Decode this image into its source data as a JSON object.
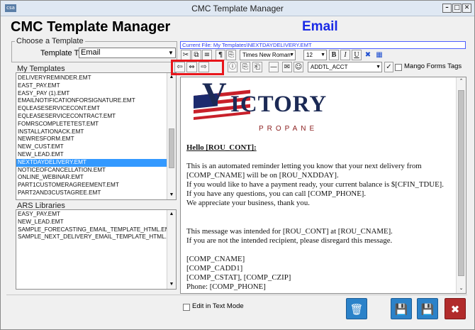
{
  "window": {
    "title": "CMC Template Manager",
    "app_icon_text": "csa",
    "controls": {
      "minimize": "–",
      "maximize": "□",
      "close": "✕"
    }
  },
  "header": {
    "app_title": "CMC Template Manager",
    "section": "Email",
    "section_color": "#1a2ae6"
  },
  "choose_template": {
    "legend": "Choose a Template",
    "type_label": "Template Type",
    "type_value": "Email"
  },
  "my_templates": {
    "label": "My Templates",
    "items": [
      "DELIVERYREMINDER.EMT",
      "EAST_PAY.EMT",
      "EASY_PAY (1).EMT",
      "EMAILNOTIFICATIONFORSIGNATURE.EMT",
      "EQLEASESERVICECONT.EMT",
      "EQLEASESERVICECONTRACT.EMT",
      "FOMRSCOMPLETETEST.EMT",
      "INSTALLATIONACK.EMT",
      "NEWRESFORM.EMT",
      "NEW_CUST.EMT",
      "NEW_LEAD.EMT",
      "NEXTDAYDELIVERY.EMT",
      "NOTICEOFCANCELLATION.EMT",
      "ONLINE_WEBINAR.EMT",
      "PART1CUSTOMERAGREEMENT.EMT",
      "PART2AND3CUSTAGREE.EMT"
    ],
    "selected": "NEXTDAYDELIVERY.EMT"
  },
  "ars_libraries": {
    "label": "ARS Libraries",
    "items": [
      "EASY_PAY.EMT",
      "NEW_LEAD.EMT",
      "SAMPLE_FORECASTING_EMAIL_TEMPLATE_HTML.EMT",
      "SAMPLE_NEXT_DELIVERY_EMAIL_TEMPLATE_HTML.EMT"
    ]
  },
  "editor": {
    "current_file": "Current File: My Templates\\NEXTDAYDELIVERY.EMT",
    "font_name": "Times New Roman",
    "font_size": "12",
    "field_select": "ADDTL_ACCT",
    "mango_label": "Mango Forms Tags",
    "toolbar_icons": {
      "cut": "✂",
      "copy": "⧉",
      "paste": "📋",
      "bullets": "≡",
      "format": "¶",
      "bold": "B",
      "italic": "I",
      "underline": "U",
      "clear": "✖",
      "table": "▦",
      "align_left": "⇦",
      "align_center": "⇔",
      "align_right": "⇨",
      "info": "ⓘ",
      "link": "⎘",
      "unlink": "⎗",
      "hr": "—",
      "image": "✉",
      "smiley": "☺",
      "apply": "✓"
    },
    "logo": {
      "v": "V",
      "rest": "ICTORY",
      "sub": "PROPANE"
    },
    "greeting": "Hello [ROU_CONT]:",
    "paragraph1": [
      "This is an automated reminder letting you know that your next delivery from",
      "[COMP_CNAME] will be on [ROU_NXDDAY].",
      "If you would like to have a payment ready, your current balance is $[CFIN_TDUE].",
      "If you have any questions, you can call [COMP_PHONE].",
      "We appreciate your business, thank you."
    ],
    "paragraph2": [
      "This message was intended for [ROU_CONT] at [ROU_CNAME].",
      "If you are not the intended recipient, please disregard this message."
    ],
    "address": [
      "[COMP_CNAME]",
      "[COMP_CADD1]",
      "[COMP_CSTAT], [COMP_CZIP]",
      "Phone: [COMP_PHONE]"
    ]
  },
  "footer": {
    "edit_in_text_mode": "Edit in Text Mode",
    "icons": {
      "delete": "🗑",
      "save": "💾",
      "save_new": "💾",
      "close": "✖"
    }
  }
}
